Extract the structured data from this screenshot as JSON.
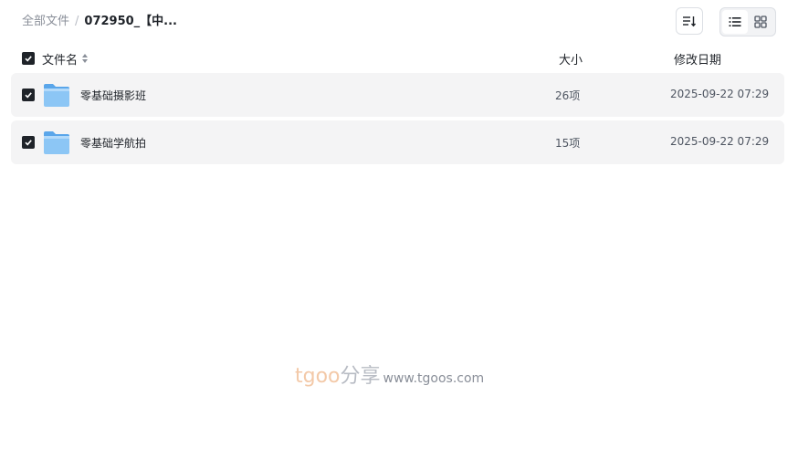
{
  "breadcrumb": {
    "root": "全部文件",
    "separator": "/",
    "current": "072950_【中..."
  },
  "toolbar": {
    "sort_icon": "sort-icon",
    "view_list_icon": "list-view-icon",
    "view_grid_icon": "grid-view-icon",
    "active_view": "list"
  },
  "table": {
    "select_all_checked": true,
    "columns": {
      "name": "文件名",
      "size": "大小",
      "date": "修改日期"
    },
    "rows": [
      {
        "checked": true,
        "icon": "folder-icon",
        "name": "零基础摄影班",
        "size": "26项",
        "date": "2025-09-22 07:29"
      },
      {
        "checked": true,
        "icon": "folder-icon",
        "name": "零基础学航拍",
        "size": "15项",
        "date": "2025-09-22 07:29"
      }
    ]
  },
  "watermark": {
    "brand_latin": "tgoo",
    "brand_cn": "分享",
    "url": "www.tgoos.com"
  },
  "colors": {
    "row_background": "#f4f4f5",
    "checkbox": "#1f2329",
    "folder": "#6fb4f0",
    "watermark_brand": "#f3c9a8"
  }
}
